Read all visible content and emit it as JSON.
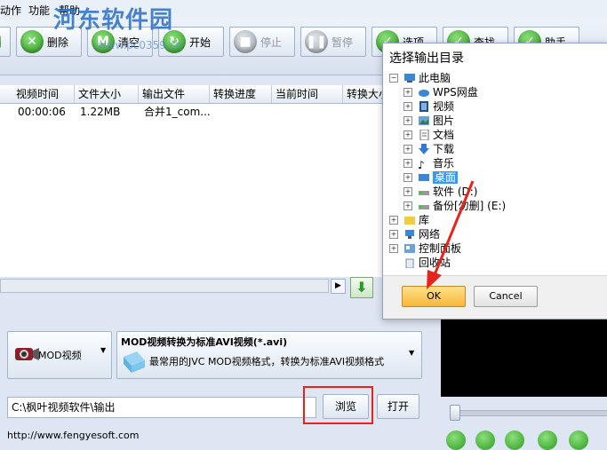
{
  "watermark": {
    "text": "河东软件园",
    "url": "www.pc0359.cn"
  },
  "menu": {
    "items": [
      "动作",
      "功能",
      "帮助"
    ]
  },
  "toolbar": {
    "delete": "删除",
    "clear": "清空",
    "start": "开始",
    "stop": "停止",
    "pause": "暂停",
    "b6": "选项",
    "b7": "查找",
    "b8": "助手"
  },
  "file_list": {
    "columns": [
      "视频时间",
      "文件大小",
      "输出文件",
      "转换进度",
      "当前时间",
      "转换大小"
    ],
    "rows": [
      {
        "duration": "00:00:06",
        "size": "1.22MB",
        "output": "合并1_com...",
        "progress": "",
        "current": "",
        "converted": ""
      }
    ]
  },
  "format": {
    "device_label": "MOD视频",
    "title": "MOD视频转换为标准AVI视频(*.avi)",
    "description": "最常用的JVC MOD视频格式，转换为标准AVI视频格式"
  },
  "output": {
    "path": "C:\\枫叶视频软件\\输出",
    "browse": "浏览",
    "open": "打开"
  },
  "footer": {
    "url": "http://www.fengyesoft.com"
  },
  "dialog": {
    "title": "选择输出目录",
    "tree": {
      "root": "此电脑",
      "children": [
        "WPS网盘",
        "视频",
        "图片",
        "文档",
        "下载",
        "音乐",
        "桌面",
        "软件 (D:)",
        "备份[勿删] (E:)"
      ],
      "top_level": [
        "库",
        "网络",
        "控制面板",
        "回收站"
      ]
    },
    "selected": "桌面",
    "ok": "OK",
    "cancel": "Cancel"
  },
  "colors": {
    "highlight": "#e8231c",
    "selection": "#3399ff",
    "ok_button": "#f7b73a"
  }
}
